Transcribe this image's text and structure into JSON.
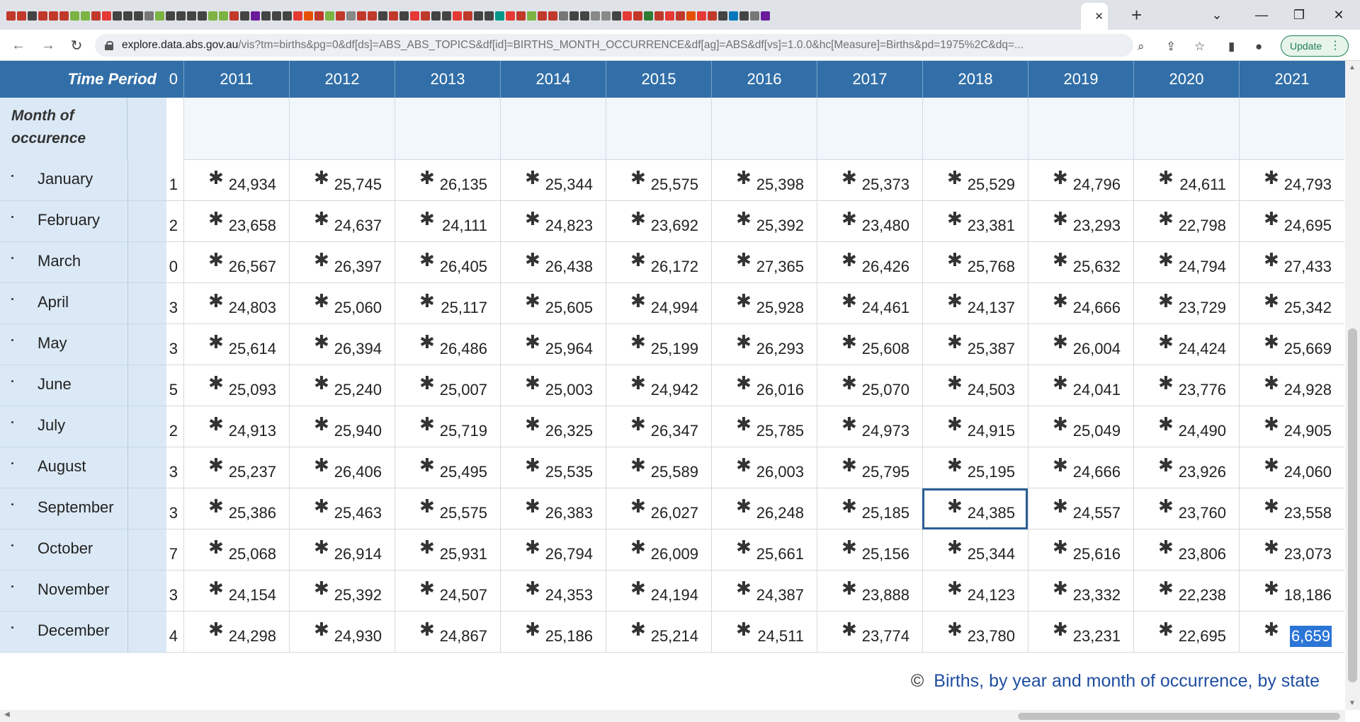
{
  "browser": {
    "url_domain": "explore.data.abs.gov.au",
    "url_path": "/vis?tm=births&pg=0&df[ds]=ABS_ABS_TOPICS&df[id]=BIRTHS_MONTH_OCCURRENCE&df[ag]=ABS&df[vs]=1.0.0&hc[Measure]=Births&pd=1975%2C&dq=...",
    "update_label": "Update",
    "favicon_colors": [
      "#c0392b",
      "#c0392b",
      "#444444",
      "#c0392b",
      "#c0392b",
      "#c0392b",
      "#7cb342",
      "#7cb342",
      "#c0392b",
      "#e53935",
      "#444444",
      "#444444",
      "#444444",
      "#777777",
      "#7cb342",
      "#444444",
      "#444444",
      "#444444",
      "#444444",
      "#7cb342",
      "#7cb342",
      "#c0392b",
      "#444444",
      "#6a1b9a",
      "#444444",
      "#444444",
      "#444444",
      "#e53935",
      "#e65100",
      "#c0392b",
      "#7cb342",
      "#c0392b",
      "#888888",
      "#c0392b",
      "#c0392b",
      "#444444",
      "#c0392b",
      "#444444",
      "#e53935",
      "#c0392b",
      "#444444",
      "#444444",
      "#e53935",
      "#c0392b",
      "#444444",
      "#444444",
      "#009688",
      "#e53935",
      "#c0392b",
      "#7cb342",
      "#c0392b",
      "#c0392b",
      "#777777",
      "#444444",
      "#444444",
      "#888888",
      "#888888",
      "#444444",
      "#e53935",
      "#c0392b",
      "#2e7d32",
      "#c0392b",
      "#e53935",
      "#c0392b",
      "#e65100",
      "#e53935",
      "#c0392b",
      "#444444",
      "#0277bd",
      "#444444",
      "#777777",
      "#6a1b9a"
    ]
  },
  "table": {
    "time_period_label": "Time Period",
    "month_header_line1": "Month of",
    "month_header_line2": "occurence",
    "years": [
      "2011",
      "2012",
      "2013",
      "2014",
      "2015",
      "2016",
      "2017",
      "2018",
      "2019",
      "2020",
      "2021"
    ],
    "partial_column": [
      "1",
      "2",
      "0",
      "3",
      "3",
      "5",
      "2",
      "3",
      "3",
      "7",
      "3",
      "4"
    ],
    "partial_header": "0",
    "flag_symbol": "✱",
    "rows": [
      {
        "month": "January",
        "values": [
          "24,934",
          "25,745",
          "26,135",
          "25,344",
          "25,575",
          "25,398",
          "25,373",
          "25,529",
          "24,796",
          "24,611",
          "24,793"
        ]
      },
      {
        "month": "February",
        "values": [
          "23,658",
          "24,637",
          "24,111",
          "24,823",
          "23,692",
          "25,392",
          "23,480",
          "23,381",
          "23,293",
          "22,798",
          "24,695"
        ]
      },
      {
        "month": "March",
        "values": [
          "26,567",
          "26,397",
          "26,405",
          "26,438",
          "26,172",
          "27,365",
          "26,426",
          "25,768",
          "25,632",
          "24,794",
          "27,433"
        ]
      },
      {
        "month": "April",
        "values": [
          "24,803",
          "25,060",
          "25,117",
          "25,605",
          "24,994",
          "25,928",
          "24,461",
          "24,137",
          "24,666",
          "23,729",
          "25,342"
        ]
      },
      {
        "month": "May",
        "values": [
          "25,614",
          "26,394",
          "26,486",
          "25,964",
          "25,199",
          "26,293",
          "25,608",
          "25,387",
          "26,004",
          "24,424",
          "25,669"
        ]
      },
      {
        "month": "June",
        "values": [
          "25,093",
          "25,240",
          "25,007",
          "25,003",
          "24,942",
          "26,016",
          "25,070",
          "24,503",
          "24,041",
          "23,776",
          "24,928"
        ]
      },
      {
        "month": "July",
        "values": [
          "24,913",
          "25,940",
          "25,719",
          "26,325",
          "26,347",
          "25,785",
          "24,973",
          "24,915",
          "25,049",
          "24,490",
          "24,905"
        ]
      },
      {
        "month": "August",
        "values": [
          "25,237",
          "26,406",
          "25,495",
          "25,535",
          "25,589",
          "26,003",
          "25,795",
          "25,195",
          "24,666",
          "23,926",
          "24,060"
        ]
      },
      {
        "month": "September",
        "values": [
          "25,386",
          "25,463",
          "25,575",
          "26,383",
          "26,027",
          "26,248",
          "25,185",
          "24,385",
          "24,557",
          "23,760",
          "23,558"
        ]
      },
      {
        "month": "October",
        "values": [
          "25,068",
          "26,914",
          "25,931",
          "26,794",
          "26,009",
          "25,661",
          "25,156",
          "25,344",
          "25,616",
          "23,806",
          "23,073"
        ]
      },
      {
        "month": "November",
        "values": [
          "24,154",
          "25,392",
          "24,507",
          "24,353",
          "24,194",
          "24,387",
          "23,888",
          "24,123",
          "23,332",
          "22,238",
          "18,186"
        ]
      },
      {
        "month": "December",
        "values": [
          "24,298",
          "24,930",
          "24,867",
          "25,186",
          "25,214",
          "24,511",
          "23,774",
          "23,780",
          "23,231",
          "22,695",
          "6,659"
        ]
      }
    ],
    "selected_cell": {
      "month": "September",
      "year": "2018"
    },
    "highlighted_cell": {
      "month": "December",
      "year": "2021"
    }
  },
  "footer": {
    "copyright_symbol": "©",
    "link_text": "Births, by year and month of occurrence, by state"
  }
}
